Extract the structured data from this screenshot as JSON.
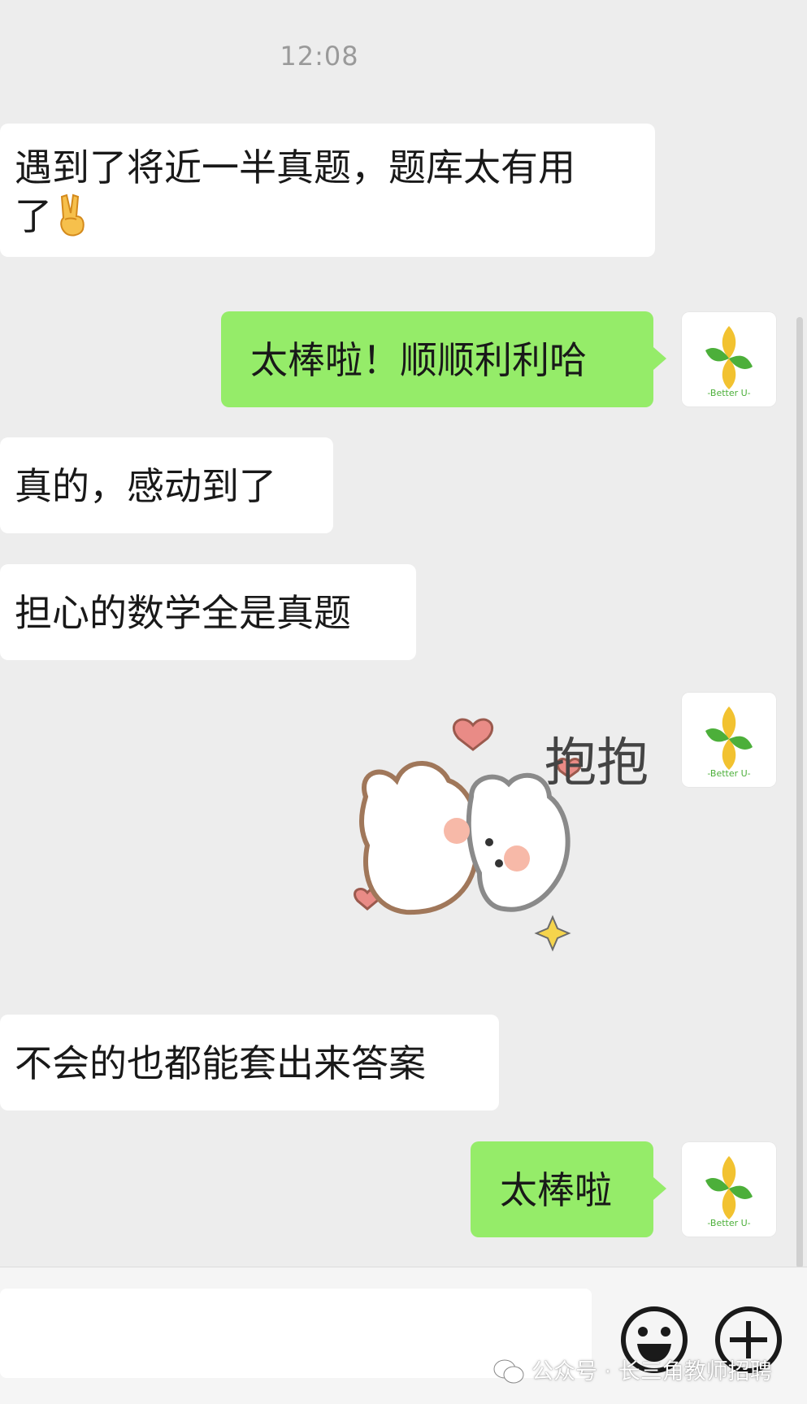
{
  "chat": {
    "timestamp": "12:08",
    "messages": [
      {
        "side": "left",
        "text": "遇到了将近一半真题，题库太有用了",
        "emoji": "victory-hand-emoji"
      },
      {
        "side": "right",
        "text": "太棒啦！顺顺利利哈"
      },
      {
        "side": "left",
        "text": "真的，感动到了"
      },
      {
        "side": "left",
        "text": "担心的数学全是真题"
      },
      {
        "side": "right",
        "type": "sticker",
        "sticker_text": "抱抱"
      },
      {
        "side": "left",
        "text": "不会的也都能套出来答案"
      },
      {
        "side": "right",
        "text": "太棒啦"
      }
    ],
    "line1": "遇到了将近一半真题，题库太有用",
    "line2": "了",
    "avatar_text": "-Better U-"
  },
  "input": {
    "value": "",
    "placeholder": "",
    "emoji_button": "smiley-icon",
    "more_button": "plus-circle-icon"
  },
  "watermark": {
    "text": "公众号 · 长三角教师招聘"
  },
  "colors": {
    "background": "#ededed",
    "self_bubble": "#95ec69",
    "other_bubble": "#ffffff",
    "timestamp": "#9a9a9a"
  }
}
